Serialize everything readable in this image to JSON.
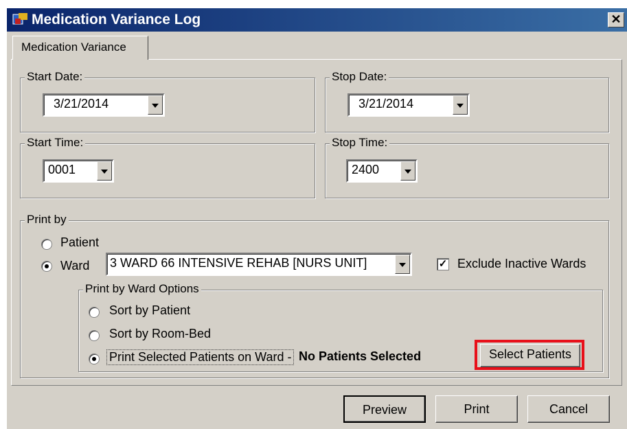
{
  "window": {
    "title": "Medication Variance Log",
    "close_label": "✕"
  },
  "tab": {
    "label": "Medication Variance"
  },
  "start_date": {
    "label": "Start Date:",
    "value": "3/21/2014"
  },
  "stop_date": {
    "label": "Stop Date:",
    "value": "3/21/2014"
  },
  "start_time": {
    "label": "Start Time:",
    "value": "0001"
  },
  "stop_time": {
    "label": "Stop Time:",
    "value": "2400"
  },
  "print_by": {
    "label": "Print by",
    "patient_label": "Patient",
    "ward_label": "Ward",
    "selected": "Ward",
    "ward_value": "3 WARD 66 INTENSIVE REHAB [NURS UNIT]",
    "exclude_inactive_label": "Exclude Inactive Wards",
    "exclude_inactive_checked": true
  },
  "ward_options": {
    "label": "Print by Ward Options",
    "sort_patient_label": "Sort by Patient",
    "sort_room_label": "Sort by Room-Bed",
    "print_selected_label": "Print Selected Patients on Ward -",
    "selected": "Print Selected Patients on Ward",
    "status_text": "No Patients Selected",
    "select_button_label": "Select Patients",
    "highlight_color": "#e8101a"
  },
  "buttons": {
    "preview": "Preview",
    "print": "Print",
    "cancel": "Cancel"
  }
}
